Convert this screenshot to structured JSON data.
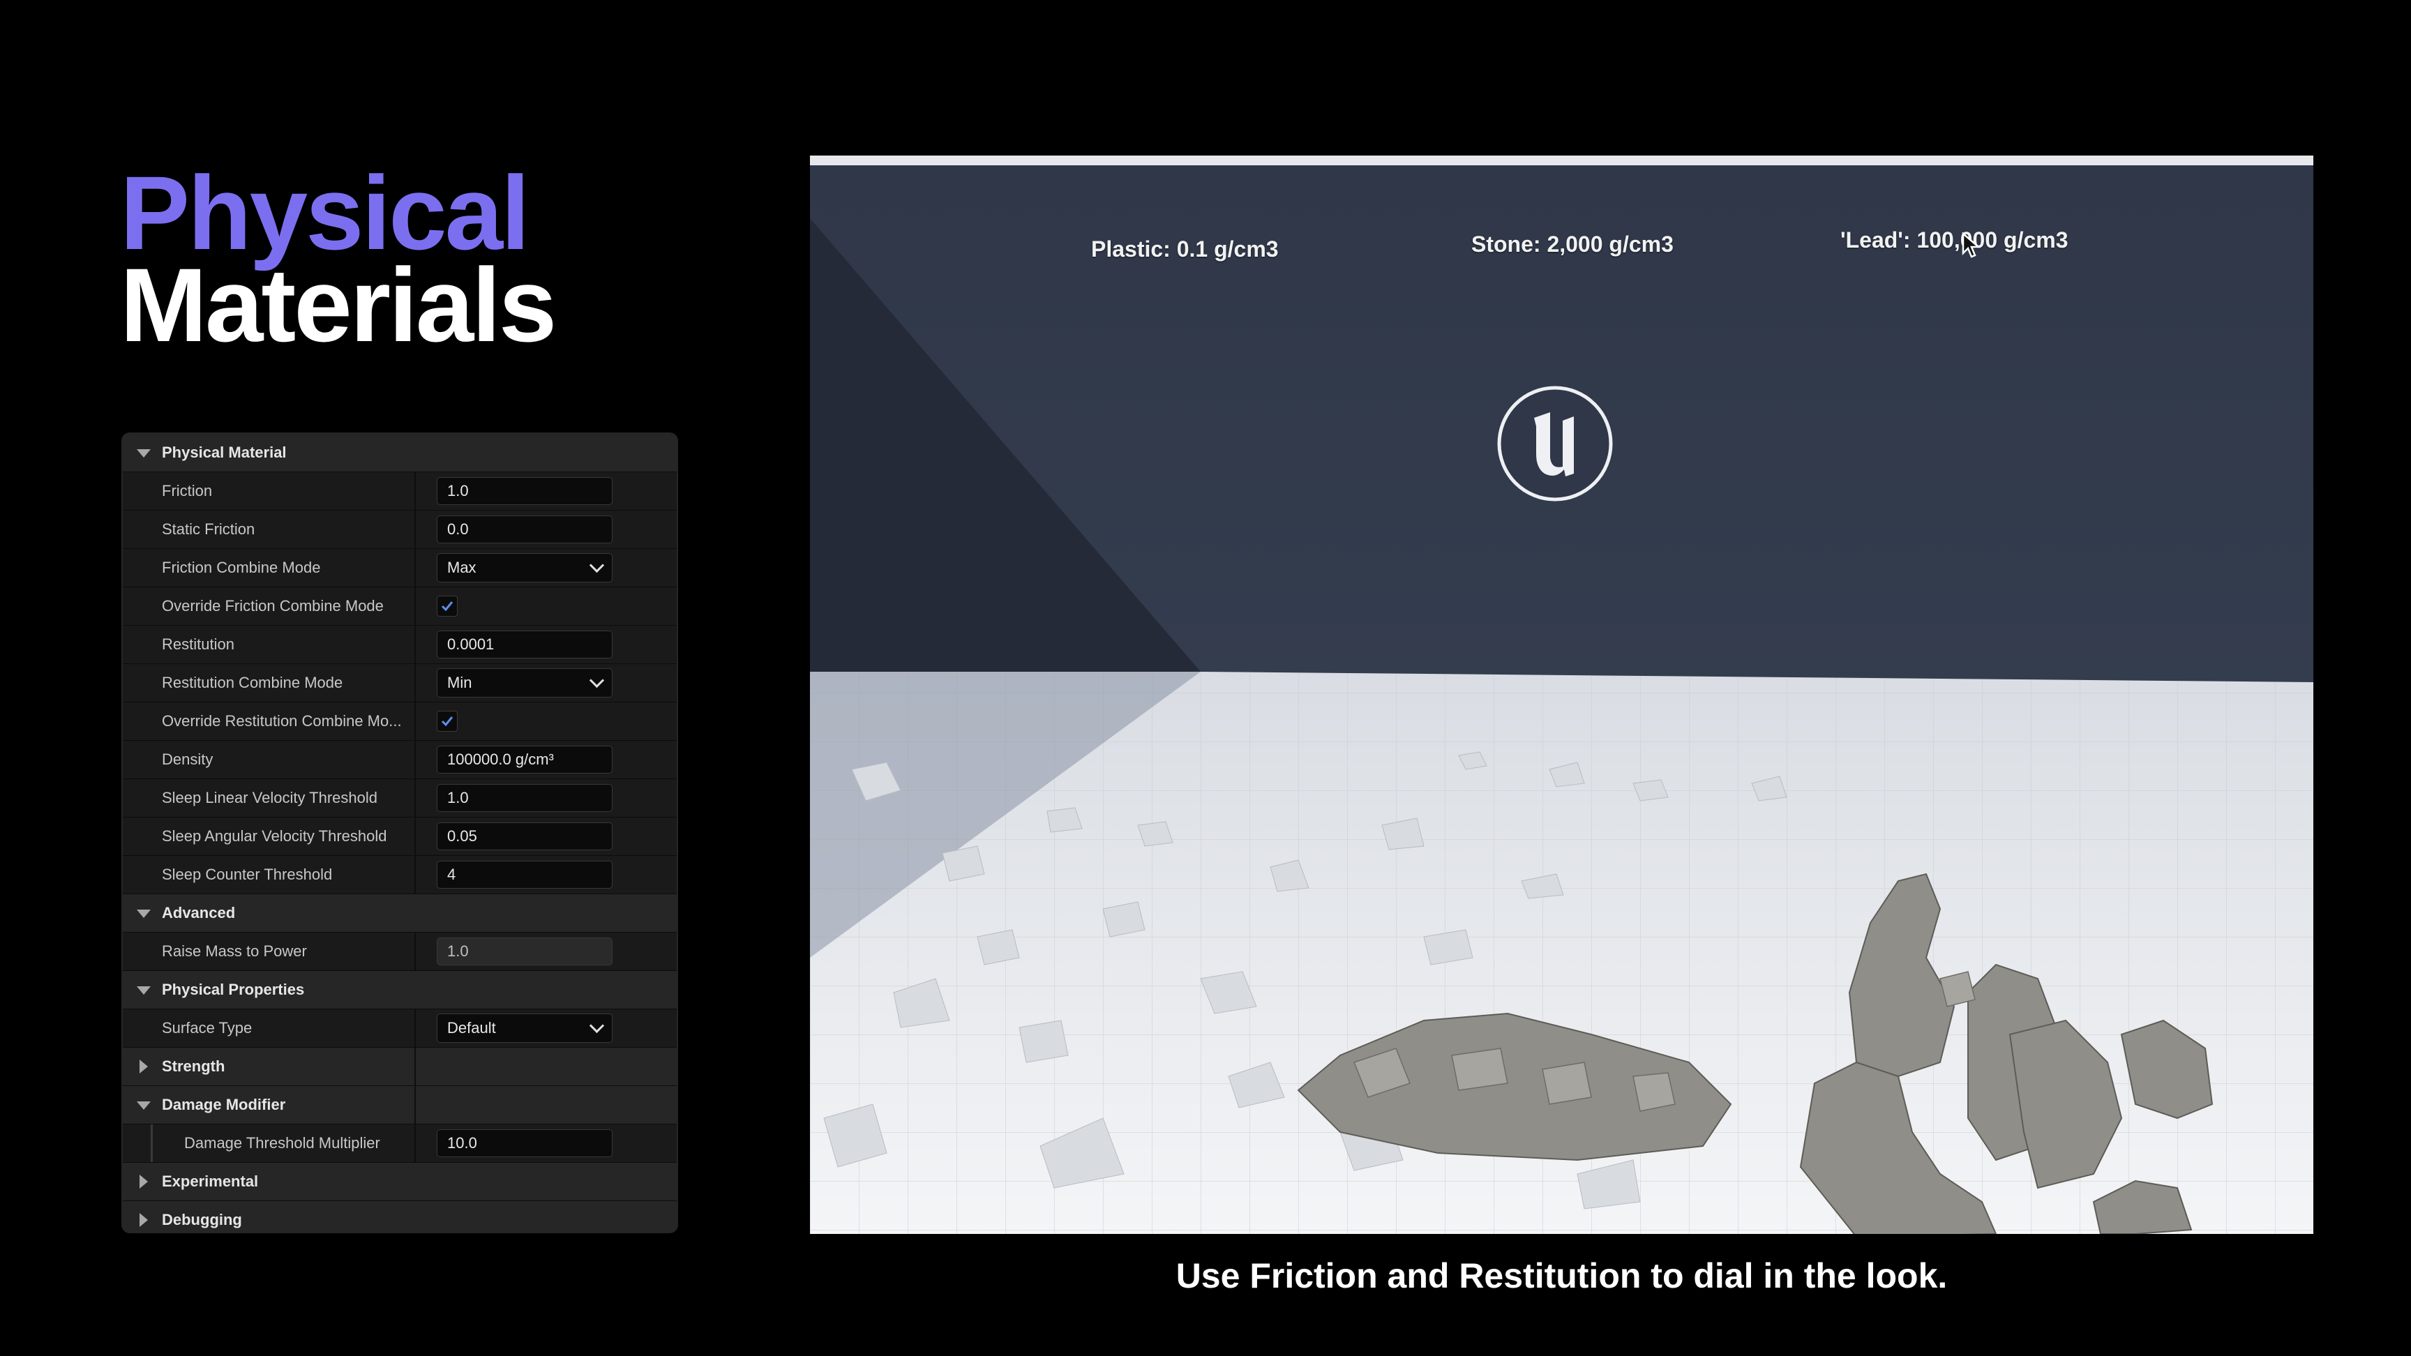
{
  "title": {
    "line1": "Physical",
    "line2": "Materials"
  },
  "panel": {
    "rows": [
      {
        "type": "section",
        "label": "Physical Material",
        "expanded": true
      },
      {
        "type": "text",
        "label": "Friction",
        "value": "1.0"
      },
      {
        "type": "text",
        "label": "Static Friction",
        "value": "0.0"
      },
      {
        "type": "select",
        "label": "Friction Combine Mode",
        "value": "Max"
      },
      {
        "type": "check",
        "label": "Override Friction Combine Mode",
        "checked": true
      },
      {
        "type": "text",
        "label": "Restitution",
        "value": "0.0001"
      },
      {
        "type": "select",
        "label": "Restitution Combine Mode",
        "value": "Min"
      },
      {
        "type": "check",
        "label": "Override Restitution Combine Mo...",
        "checked": true
      },
      {
        "type": "text",
        "label": "Density",
        "value": "100000.0 g/cm³"
      },
      {
        "type": "text",
        "label": "Sleep Linear Velocity Threshold",
        "value": "1.0"
      },
      {
        "type": "text",
        "label": "Sleep Angular Velocity Threshold",
        "value": "0.05"
      },
      {
        "type": "text",
        "label": "Sleep Counter Threshold",
        "value": "4"
      },
      {
        "type": "section",
        "label": "Advanced",
        "expanded": true
      },
      {
        "type": "text",
        "label": "Raise Mass to Power",
        "value": "1.0",
        "disabled": true
      },
      {
        "type": "section",
        "label": "Physical Properties",
        "expanded": true
      },
      {
        "type": "select",
        "label": "Surface Type",
        "value": "Default"
      },
      {
        "type": "group",
        "label": "Strength",
        "expanded": false
      },
      {
        "type": "group",
        "label": "Damage Modifier",
        "expanded": true
      },
      {
        "type": "text",
        "label": "Damage Threshold Multiplier",
        "value": "10.0",
        "sub": true
      },
      {
        "type": "section",
        "label": "Experimental",
        "expanded": false
      },
      {
        "type": "section",
        "label": "Debugging",
        "expanded": false
      }
    ]
  },
  "viewport": {
    "labels": {
      "plastic": "Plastic: 0.1 g/cm3",
      "stone": "Stone: 2,000 g/cm3",
      "lead": "'Lead': 100,000 g/cm3"
    },
    "logo_icon": "unreal-engine-logo-icon"
  },
  "caption": "Use Friction and Restitution to dial in the look.",
  "colors": {
    "accent": "#7b6ff0",
    "background": "#000000",
    "wall": "#2b3344",
    "floor": "#e9ecef"
  }
}
